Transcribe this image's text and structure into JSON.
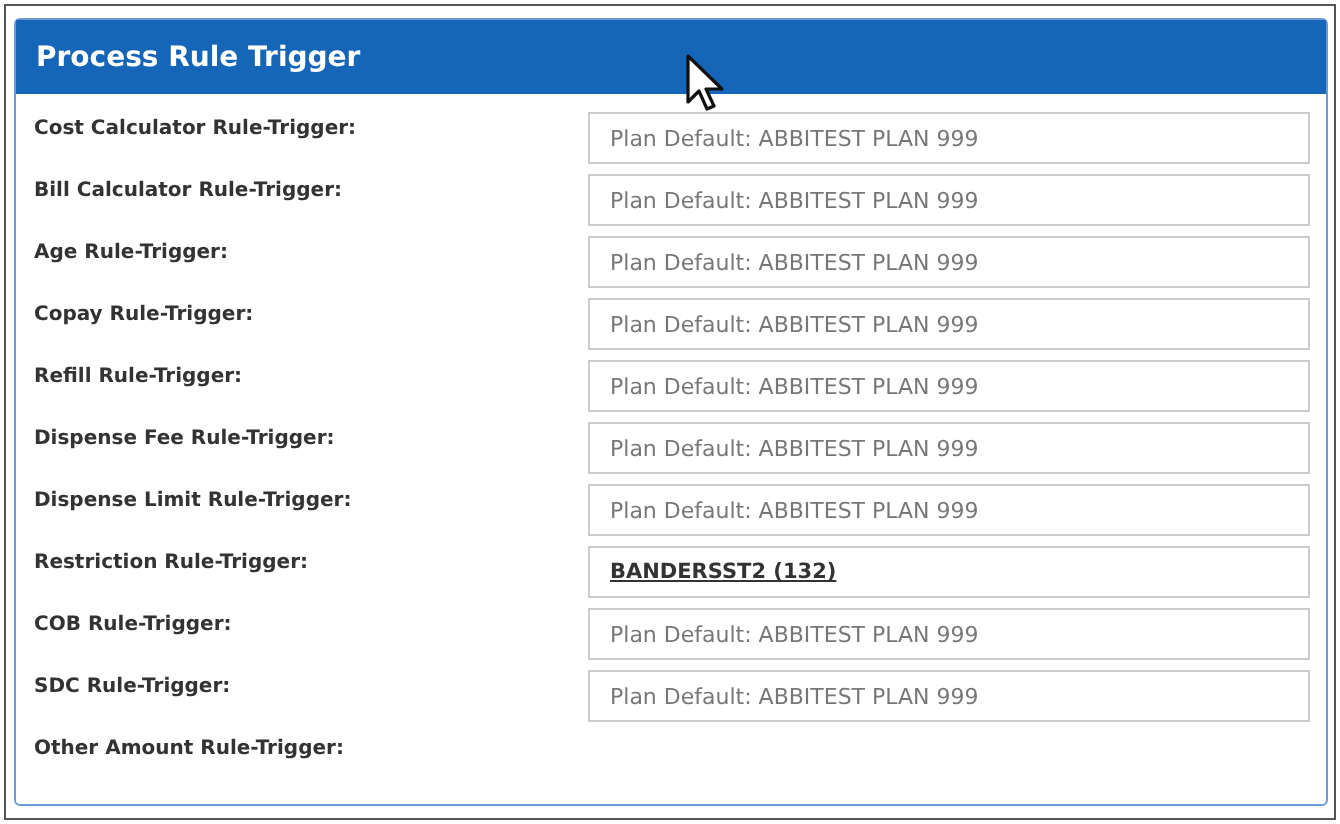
{
  "panel": {
    "title": "Process Rule Trigger"
  },
  "rows": [
    {
      "label": "Cost Calculator Rule-Trigger:",
      "kind": "placeholder",
      "placeholder": "Plan Default: ABBITEST PLAN 999"
    },
    {
      "label": "Bill Calculator Rule-Trigger:",
      "kind": "placeholder",
      "placeholder": "Plan Default: ABBITEST PLAN 999"
    },
    {
      "label": "Age Rule-Trigger:",
      "kind": "placeholder",
      "placeholder": "Plan Default: ABBITEST PLAN 999"
    },
    {
      "label": "Copay Rule-Trigger:",
      "kind": "placeholder",
      "placeholder": "Plan Default: ABBITEST PLAN 999"
    },
    {
      "label": "Refill Rule-Trigger:",
      "kind": "placeholder",
      "placeholder": "Plan Default: ABBITEST PLAN 999"
    },
    {
      "label": "Dispense Fee Rule-Trigger:",
      "kind": "placeholder",
      "placeholder": "Plan Default: ABBITEST PLAN 999"
    },
    {
      "label": "Dispense Limit Rule-Trigger:",
      "kind": "placeholder",
      "placeholder": "Plan Default: ABBITEST PLAN 999"
    },
    {
      "label": "Restriction Rule-Trigger:",
      "kind": "link",
      "value": "BANDERSST2 (132)"
    },
    {
      "label": "COB Rule-Trigger:",
      "kind": "placeholder",
      "placeholder": "Plan Default: ABBITEST PLAN 999"
    },
    {
      "label": "SDC Rule-Trigger:",
      "kind": "placeholder",
      "placeholder": "Plan Default: ABBITEST PLAN 999"
    },
    {
      "label": "Other Amount Rule-Trigger:",
      "kind": "none"
    }
  ]
}
